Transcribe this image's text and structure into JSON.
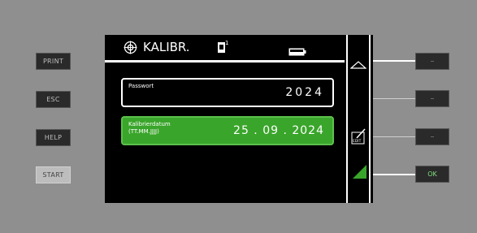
{
  "hardware_buttons": {
    "print": "PRINT",
    "esc": "ESC",
    "help": "HELP",
    "start": "START"
  },
  "screen": {
    "title": "KALIBR.",
    "fields": [
      {
        "label": "Passwort",
        "value": "2024"
      },
      {
        "label": "Kalibrierdatum\n(TT.MM.JJJJ)",
        "value": "25 . 09 . 2024"
      }
    ]
  },
  "softkeys": {
    "ok_label": "OK"
  },
  "colors": {
    "accent_green": "#3aa52b",
    "ok_text": "#7fe07f"
  },
  "icons": [
    "target-icon",
    "battery-icon",
    "sensor-icon",
    "triangle-up-icon",
    "edit-icon",
    "ramp-icon"
  ]
}
